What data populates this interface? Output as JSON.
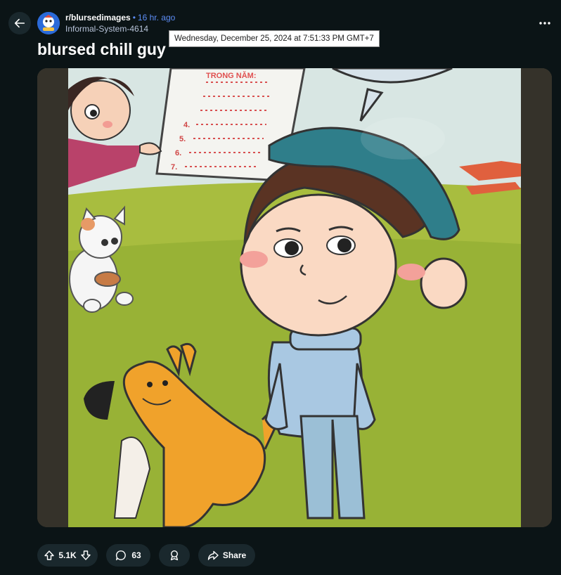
{
  "post": {
    "subreddit": "r/blursedimages",
    "separator": "•",
    "time_ago": "16 hr. ago",
    "author": "Informal-System-4614",
    "timestamp_tooltip": "Wednesday, December 25, 2024 at 7:51:33 PM GMT+7",
    "title": "blursed chill guy"
  },
  "image": {
    "list_heading": "TRONG NĂM:",
    "list_numbers": [
      "4.",
      "5.",
      "6.",
      "7."
    ]
  },
  "actions": {
    "vote_count": "5.1K",
    "comment_count": "63",
    "share_label": "Share"
  },
  "icons": {
    "back": "arrow-left-icon",
    "more": "more-horizontal-icon",
    "upvote": "arrow-up-icon",
    "downvote": "arrow-down-icon",
    "comment": "speech-bubble-icon",
    "award": "award-ribbon-icon",
    "share": "share-arrow-icon"
  },
  "colors": {
    "background": "#0b1416",
    "pill": "#1a282d",
    "link_blue": "#5d8df5",
    "subreddit_avatar": "#2b6ad8"
  }
}
